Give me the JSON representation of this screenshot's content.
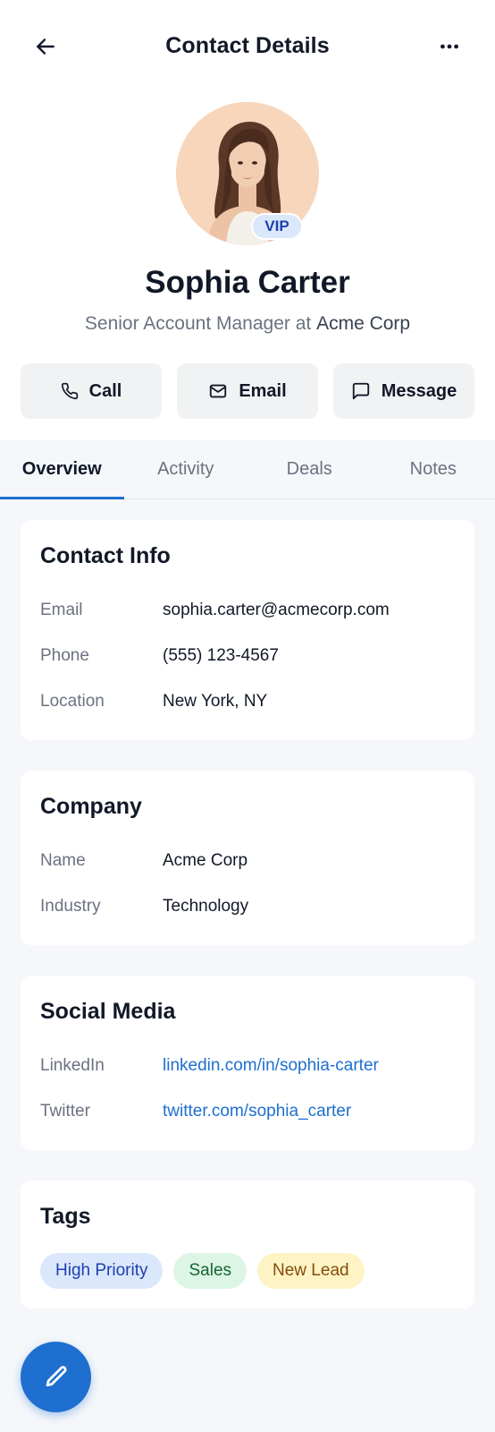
{
  "header": {
    "title": "Contact Details",
    "back_icon": "arrow-left-icon",
    "more_icon": "more-horizontal-icon"
  },
  "profile": {
    "name": "Sophia Carter",
    "role": "Senior Account Manager",
    "at": "at",
    "company": "Acme Corp",
    "badge": "VIP"
  },
  "actions": [
    {
      "label": "Call",
      "icon": "phone-icon"
    },
    {
      "label": "Email",
      "icon": "mail-icon"
    },
    {
      "label": "Message",
      "icon": "message-icon"
    }
  ],
  "tabs": [
    {
      "label": "Overview",
      "active": true
    },
    {
      "label": "Activity",
      "active": false
    },
    {
      "label": "Deals",
      "active": false
    },
    {
      "label": "Notes",
      "active": false
    }
  ],
  "contact_info": {
    "title": "Contact Info",
    "rows": [
      {
        "label": "Email",
        "value": "sophia.carter@acmecorp.com"
      },
      {
        "label": "Phone",
        "value": "(555) 123-4567"
      },
      {
        "label": "Location",
        "value": "New York, NY"
      }
    ]
  },
  "company": {
    "title": "Company",
    "rows": [
      {
        "label": "Name",
        "value": "Acme Corp"
      },
      {
        "label": "Industry",
        "value": "Technology"
      }
    ]
  },
  "social": {
    "title": "Social Media",
    "rows": [
      {
        "label": "LinkedIn",
        "value": "linkedin.com/in/sophia-carter"
      },
      {
        "label": "Twitter",
        "value": "twitter.com/sophia_carter"
      }
    ]
  },
  "tags": {
    "title": "Tags",
    "items": [
      {
        "label": "High Priority",
        "color": "#dbe7fb"
      },
      {
        "label": "Sales",
        "color": "#dcf5e4"
      },
      {
        "label": "New Lead",
        "color": "#fdf3c4"
      }
    ]
  },
  "colors": {
    "accent": "#1e6fd0",
    "background": "#f5f7fa"
  },
  "fab": {
    "icon": "pencil-icon"
  }
}
